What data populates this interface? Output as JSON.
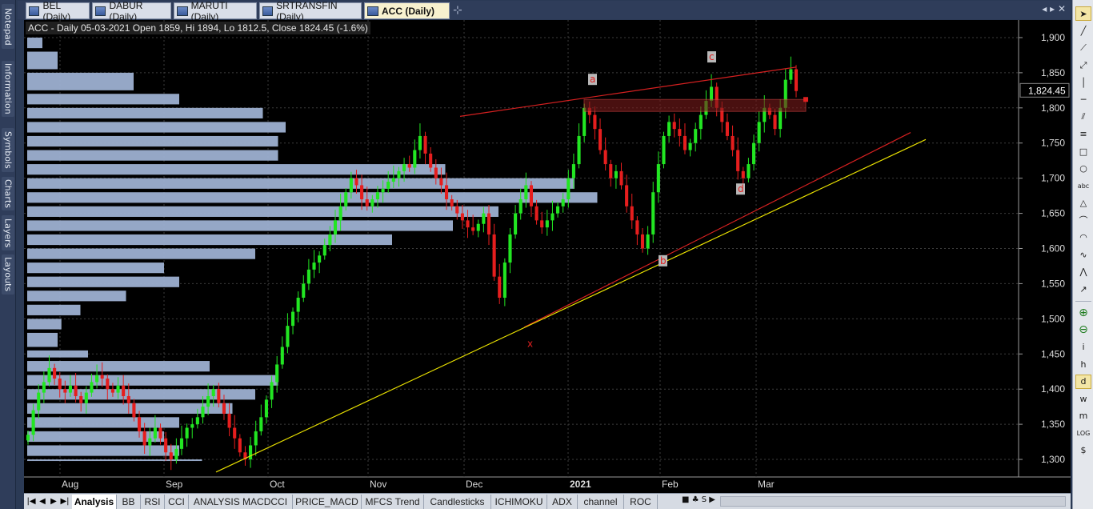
{
  "left_panel": {
    "tabs": [
      "Notepad",
      "Information",
      "Symbols",
      "Charts",
      "Layers",
      "Layouts"
    ]
  },
  "doc_tabs": {
    "tabs": [
      {
        "label": "BEL (Daily)",
        "active": false
      },
      {
        "label": "DABUR (Daily)",
        "active": false
      },
      {
        "label": "MARUTI (Daily)",
        "active": false
      },
      {
        "label": "SRTRANSFIN (Daily)",
        "active": false
      },
      {
        "label": "ACC (Daily)",
        "active": true
      }
    ],
    "new_tab_icon": "plus-icon",
    "nav": "◂ ▸ ✕"
  },
  "chart": {
    "info": "ACC - Daily 05-03-2021 Open 1859, Hi 1894, Lo 1812.5, Close 1824.45 (-1.6%)"
  },
  "chart_data": {
    "type": "candlestick",
    "title": "ACC - Daily 05-03-2021 Open 1859, Hi 1894, Lo 1812.5, Close 1824.45 (-1.6%)",
    "last_price_label": "1,824.45",
    "ylim": [
      1275,
      1925
    ],
    "y_ticks": [
      "1,300",
      "1,350",
      "1,400",
      "1,450",
      "1,500",
      "1,550",
      "1,600",
      "1,650",
      "1,700",
      "1,750",
      "1,800",
      "1,850",
      "1,900"
    ],
    "y_values": [
      1300,
      1350,
      1400,
      1450,
      1500,
      1550,
      1600,
      1650,
      1700,
      1750,
      1800,
      1850,
      1900
    ],
    "x_ticks": [
      "Aug",
      "Sep",
      "Oct",
      "Nov",
      "Dec",
      "2021",
      "Feb",
      "Mar"
    ],
    "x_tick_index": [
      40,
      170,
      300,
      425,
      545,
      675,
      790,
      910
    ],
    "wave_labels": [
      {
        "text": "a",
        "pos": [
          710,
          1836
        ]
      },
      {
        "text": "c",
        "pos": [
          859,
          1868
        ]
      },
      {
        "text": "d",
        "pos": [
          895,
          1680
        ]
      },
      {
        "text": "b",
        "pos": [
          798,
          1578
        ]
      },
      {
        "text": "x",
        "pos": [
          632,
          1460
        ]
      }
    ],
    "trendlines": [
      {
        "color": "#d42020",
        "from": [
          545,
          1788
        ],
        "to": [
          965,
          1858
        ]
      },
      {
        "color": "#d42020",
        "from": [
          625,
          1488
        ],
        "to": [
          1108,
          1765
        ]
      },
      {
        "color": "#e8e000",
        "from": [
          240,
          1282
        ],
        "to": [
          1127,
          1755
        ]
      }
    ],
    "zone": {
      "from": [
        700,
        1812
      ],
      "to": [
        977,
        1795
      ]
    },
    "closes": [
      [
        1335,
        1370,
        1395,
        1410,
        1430,
        1415,
        1400,
        1395,
        1405,
        1390,
        1380,
        1395,
        1410,
        1420,
        1415,
        1400,
        1395,
        1405,
        1390,
        1380,
        1360,
        1340,
        1320,
        1330,
        1345,
        1330,
        1310,
        1300,
        1315,
        1330,
        1345,
        1350,
        1360,
        1375,
        1390,
        1400,
        1380,
        1365,
        1345,
        1330,
        1310,
        1300,
        1320,
        1340,
        1360,
        1385,
        1410,
        1435,
        1460,
        1490,
        1510,
        1530,
        1550,
        1570,
        1580,
        1590,
        1605,
        1620,
        1640,
        1660,
        1680,
        1700,
        1690,
        1670,
        1660,
        1670,
        1680,
        1685,
        1695,
        1700,
        1710,
        1720,
        1715,
        1740,
        1760,
        1735,
        1715,
        1700,
        1690,
        1670,
        1660,
        1650,
        1640,
        1630,
        1625,
        1635,
        1650,
        1620,
        1560,
        1530,
        1580,
        1620,
        1650,
        1670,
        1690,
        1660,
        1640,
        1630,
        1640,
        1650,
        1660,
        1670,
        1700,
        1720,
        1760,
        1800,
        1790,
        1770,
        1740,
        1720,
        1700,
        1710,
        1690,
        1660,
        1640,
        1620,
        1600,
        1620,
        1680,
        1720,
        1760,
        1780,
        1770,
        1760,
        1740,
        1750,
        1770,
        1790,
        1810,
        1830,
        1800,
        1780,
        1760,
        1740,
        1710,
        1700,
        1720,
        1750,
        1780,
        1800,
        1790,
        1770,
        1800,
        1840,
        1855,
        1824
      ]
    ],
    "volume_profile": {
      "description": "horizontal price-volume histogram on the left side",
      "levels": [
        1300,
        1400,
        1500,
        1600,
        1700,
        1800
      ]
    }
  },
  "sheets": {
    "nav": [
      "|◀",
      "◀",
      "▶",
      "▶|"
    ],
    "tabs": [
      {
        "label": "Analysis",
        "active": true
      },
      {
        "label": "BB",
        "active": false
      },
      {
        "label": "RSI",
        "active": false
      },
      {
        "label": "CCI",
        "active": false
      },
      {
        "label": "ANALYSIS MACDCCI",
        "active": false
      },
      {
        "label": "PRICE_MACD",
        "active": false
      },
      {
        "label": "MFCS Trend",
        "active": false
      },
      {
        "label": "Candlesticks",
        "active": false
      },
      {
        "label": "ICHIMOKU",
        "active": false
      },
      {
        "label": "ADX",
        "active": false
      },
      {
        "label": "channel",
        "active": false
      },
      {
        "label": "ROC",
        "active": false
      }
    ],
    "lock_label": "■ ♣ S ▶"
  },
  "toolbar": {
    "tools": [
      {
        "icon": "cursor-icon",
        "glyph": "➤"
      },
      {
        "icon": "line-icon",
        "glyph": "╱"
      },
      {
        "icon": "ray-icon",
        "glyph": "⟋"
      },
      {
        "icon": "extended-line-icon",
        "glyph": "⤢"
      },
      {
        "icon": "vertical-line-icon",
        "glyph": "│"
      },
      {
        "icon": "horizontal-line-icon",
        "glyph": "─"
      },
      {
        "icon": "parallel-lines-icon",
        "glyph": "⫽"
      },
      {
        "icon": "fibonacci-icon",
        "glyph": "≡"
      },
      {
        "icon": "rectangle-icon",
        "glyph": "□"
      },
      {
        "icon": "ellipse-icon",
        "glyph": "○"
      },
      {
        "icon": "text-icon",
        "glyph": "abc"
      },
      {
        "icon": "triangle-icon",
        "glyph": "△"
      },
      {
        "icon": "arc-icon",
        "glyph": "⌒"
      },
      {
        "icon": "arc2-icon",
        "glyph": "◠"
      },
      {
        "icon": "wave-icon",
        "glyph": "∿"
      },
      {
        "icon": "zigzag-icon",
        "glyph": "⋀"
      },
      {
        "icon": "arrow-icon",
        "glyph": "↗"
      },
      {
        "icon": "zoom-in-icon",
        "glyph": "⊕"
      },
      {
        "icon": "zoom-out-icon",
        "glyph": "⊖"
      },
      {
        "icon": "italic-i-icon",
        "glyph": "i"
      },
      {
        "icon": "h-icon",
        "glyph": "h"
      },
      {
        "icon": "daily-icon",
        "glyph": "d"
      },
      {
        "icon": "weekly-icon",
        "glyph": "w"
      },
      {
        "icon": "monthly-icon",
        "glyph": "m"
      },
      {
        "icon": "log-icon",
        "glyph": "LOG"
      },
      {
        "icon": "dollar-icon",
        "glyph": "$"
      }
    ]
  }
}
